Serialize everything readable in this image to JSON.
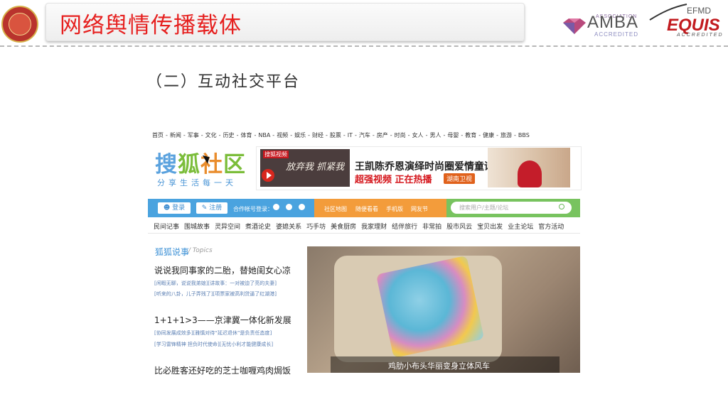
{
  "slide": {
    "title": "网络舆情传播载体",
    "subtitle": "（二）互动社交平台"
  },
  "badges": {
    "amba_assoc": "ASSOCIATION",
    "amba": "AMBA",
    "amba_accredited": "ACCREDITED",
    "efmd": "EFMD",
    "equis": "EQUIS",
    "equis_accredited": "ACCREDITED"
  },
  "sohu": {
    "topnav": [
      "首页",
      "新闻",
      "军事",
      "文化",
      "历史",
      "体育",
      "NBA",
      "视频",
      "娱乐",
      "财经",
      "股票",
      "IT",
      "汽车",
      "房产",
      "时尚",
      "女人",
      "男人",
      "母婴",
      "教育",
      "健康",
      "旅游",
      "BBS"
    ],
    "brand": {
      "a": "搜",
      "b": "狐",
      "c": "社",
      "d": "区"
    },
    "slogan": "分享生活每一天",
    "banner": {
      "logo": "搜狐视频",
      "calligraphy": "放弃我 抓紧我",
      "headline": "王凯陈乔恩演绎时尚圈爱情童话",
      "hot": "超强视频 正在热播",
      "tv": "湖南卫视"
    },
    "login": "登录",
    "register": "注册",
    "coop_login": "合作帐号登录：",
    "orange_links": [
      "社区地图",
      "随便看看",
      "手机版",
      "网友节"
    ],
    "search_placeholder": "搜索用户/主题/论坛",
    "categories": [
      "民间记事",
      "围城故事",
      "灵异空间",
      "煮酒论史",
      "婆媳关系",
      "巧手坊",
      "美食厨房",
      "我家理财",
      "结伴旅行",
      "非常拍",
      "股市风云",
      "宝贝出发",
      "业主论坛",
      "官方活动"
    ],
    "topics": {
      "title": "狐狐说事",
      "title_sub": "/ Topics",
      "items": [
        {
          "headline": "说说我同事家的二胎，替她闺女心凉",
          "subs": [
            "[闲暇无聊，说说我弟媳][讲故事：一对被迫了亮的夫妻]",
            "[听来的八卦，儿子弄残了][项票家被高利贷逼了红湖港]"
          ]
        },
        {
          "headline": "1+1+1>3——京津冀一体化新发展",
          "subs": [
            "[协同发展成效多][雅慎对待“延迟退休”是负责任态度]",
            "[学习雷锋精神 担负时代使命][无忧小利才能健康成长]"
          ]
        },
        {
          "headline": "比必胜客还好吃的芝士咖喱鸡肉焗饭",
          "subs": []
        }
      ]
    },
    "photo_caption": "鸡肋小布头华丽变身立体风车"
  }
}
